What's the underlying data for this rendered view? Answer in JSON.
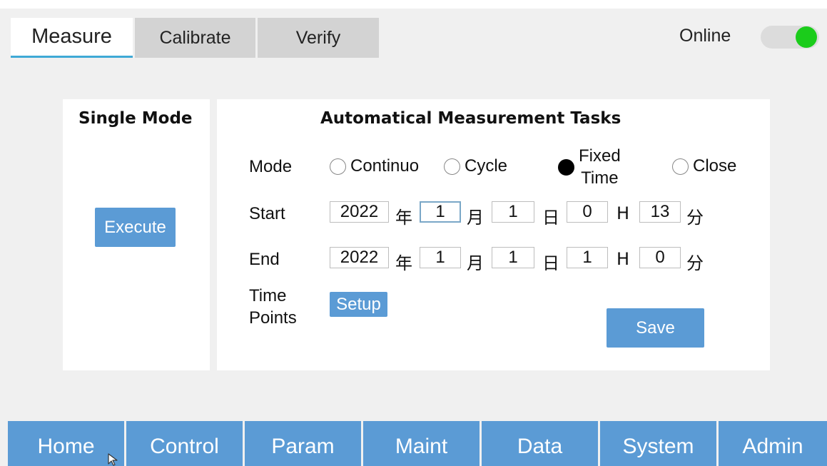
{
  "tabs": [
    {
      "label": "Measure"
    },
    {
      "label": "Calibrate"
    },
    {
      "label": "Verify"
    }
  ],
  "status": {
    "online_label": "Online",
    "online": true,
    "toggle_color": "#1bcc1b"
  },
  "single_mode": {
    "title": "Single Mode",
    "execute_label": "Execute"
  },
  "auto_tasks": {
    "title": "Automatical Measurement Tasks",
    "mode_label": "Mode",
    "modes": [
      {
        "label": "Continuo",
        "selected": false
      },
      {
        "label": "Cycle",
        "selected": false
      },
      {
        "label_line1": "Fixed",
        "label_line2": "Time",
        "selected": true
      },
      {
        "label": "Close",
        "selected": false
      }
    ],
    "start": {
      "label": "Start",
      "year": "2022",
      "month": "1",
      "day": "1",
      "hour": "0",
      "minute": "13"
    },
    "end": {
      "label": "End",
      "year": "2022",
      "month": "1",
      "day": "1",
      "hour": "1",
      "minute": "0"
    },
    "units": {
      "year": "年",
      "month": "月",
      "day": "日",
      "hour": "H",
      "minute": "分"
    },
    "time_points_line1": "Time",
    "time_points_line2": "Points",
    "setup_label": "Setup",
    "save_label": "Save"
  },
  "nav": [
    {
      "label": "Home"
    },
    {
      "label": "Control"
    },
    {
      "label": "Param"
    },
    {
      "label": "Maint"
    },
    {
      "label": "Data"
    },
    {
      "label": "System"
    },
    {
      "label": "Admin"
    }
  ],
  "colors": {
    "accent_blue": "#5b9bd5",
    "tab_underline": "#3fa9d6"
  }
}
